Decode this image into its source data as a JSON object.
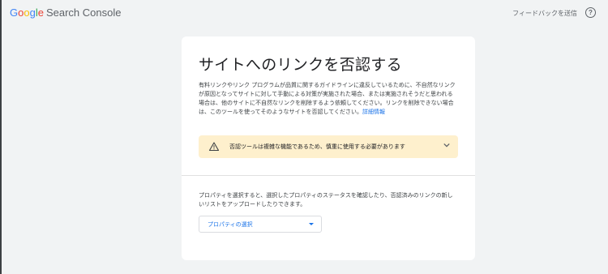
{
  "header": {
    "logo_letters": [
      "G",
      "o",
      "o",
      "g",
      "l",
      "e"
    ],
    "logo_suffix": "Search Console",
    "feedback_label": "フィードバックを送信",
    "help_label": "?"
  },
  "main": {
    "title": "サイトへのリンクを否認する",
    "description": "有料リンクやリンク プログラムが品質に関するガイドラインに違反しているために、不自然なリンクが原因となってサイトに対して手動による対策が実施された場合、または実施されそうだと思われる場合は、他のサイトに不自然なリンクを削除するよう依頼してください。リンクを削除できない場合は、このツールを使ってそのようなサイトを否認してください。",
    "learn_more": "詳細情報",
    "warning_text": "否認ツールは複雑な機能であるため、慎重に使用する必要があります",
    "select_description": "プロパティを選択すると、選択したプロパティのステータスを確認したり、否認済みのリンクの新しいリストをアップロードしたりできます。",
    "select_placeholder": "プロパティの選択"
  },
  "icons": {
    "warning": "warning-triangle-icon",
    "expand": "chevron-down-icon",
    "dropdown": "dropdown-arrow-icon",
    "help": "help-circle-icon"
  },
  "colors": {
    "background": "#f1f3f4",
    "warning_background": "#fef0cd",
    "link": "#1a73e8"
  }
}
